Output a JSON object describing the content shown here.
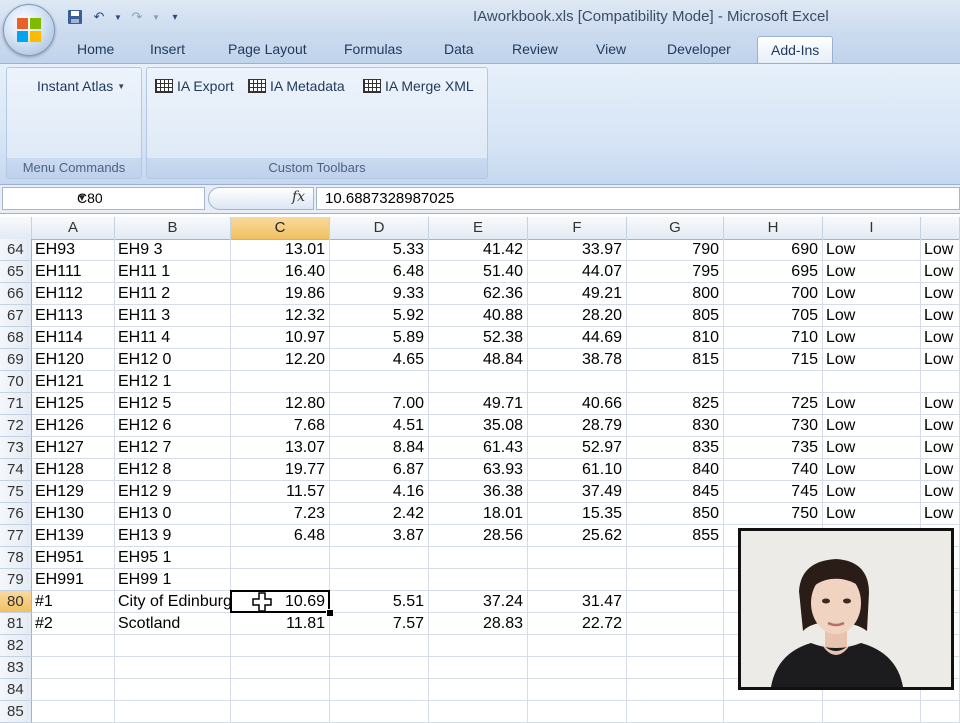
{
  "window": {
    "title": "IAworkbook.xls  [Compatibility Mode] - Microsoft Excel"
  },
  "qat": {
    "icons": [
      "save-icon",
      "undo-icon",
      "redo-icon",
      "customize-icon"
    ]
  },
  "tabs": [
    "Home",
    "Insert",
    "Page Layout",
    "Formulas",
    "Data",
    "Review",
    "View",
    "Developer",
    "Add-Ins"
  ],
  "active_tab": "Add-Ins",
  "ribbon": {
    "menu_commands": {
      "label": "Menu Commands",
      "button": "Instant Atlas"
    },
    "custom_toolbars": {
      "label": "Custom Toolbars",
      "buttons": [
        "IA Export",
        "IA Metadata",
        "IA Merge XML"
      ]
    }
  },
  "formula_bar": {
    "name_box": "C80",
    "fx": "fx",
    "value": "10.6887328987025"
  },
  "columns": [
    "A",
    "B",
    "C",
    "D",
    "E",
    "F",
    "G",
    "H",
    "I",
    ""
  ],
  "selected_column": "C",
  "rows": [
    {
      "num": "64",
      "cells": [
        "EH93",
        "EH9 3",
        "13.01",
        "5.33",
        "41.42",
        "33.97",
        "790",
        "690",
        "Low",
        "Low"
      ]
    },
    {
      "num": "65",
      "cells": [
        "EH111",
        "EH11 1",
        "16.40",
        "6.48",
        "51.40",
        "44.07",
        "795",
        "695",
        "Low",
        "Low"
      ]
    },
    {
      "num": "66",
      "cells": [
        "EH112",
        "EH11 2",
        "19.86",
        "9.33",
        "62.36",
        "49.21",
        "800",
        "700",
        "Low",
        "Low"
      ]
    },
    {
      "num": "67",
      "cells": [
        "EH113",
        "EH11 3",
        "12.32",
        "5.92",
        "40.88",
        "28.20",
        "805",
        "705",
        "Low",
        "Low"
      ]
    },
    {
      "num": "68",
      "cells": [
        "EH114",
        "EH11 4",
        "10.97",
        "5.89",
        "52.38",
        "44.69",
        "810",
        "710",
        "Low",
        "Low"
      ]
    },
    {
      "num": "69",
      "cells": [
        "EH120",
        "EH12 0",
        "12.20",
        "4.65",
        "48.84",
        "38.78",
        "815",
        "715",
        "Low",
        "Low"
      ]
    },
    {
      "num": "70",
      "cells": [
        "EH121",
        "EH12 1",
        "",
        "",
        "",
        "",
        "",
        "",
        "",
        ""
      ]
    },
    {
      "num": "71",
      "cells": [
        "EH125",
        "EH12 5",
        "12.80",
        "7.00",
        "49.71",
        "40.66",
        "825",
        "725",
        "Low",
        "Low"
      ]
    },
    {
      "num": "72",
      "cells": [
        "EH126",
        "EH12 6",
        "7.68",
        "4.51",
        "35.08",
        "28.79",
        "830",
        "730",
        "Low",
        "Low"
      ]
    },
    {
      "num": "73",
      "cells": [
        "EH127",
        "EH12 7",
        "13.07",
        "8.84",
        "61.43",
        "52.97",
        "835",
        "735",
        "Low",
        "Low"
      ]
    },
    {
      "num": "74",
      "cells": [
        "EH128",
        "EH12 8",
        "19.77",
        "6.87",
        "63.93",
        "61.10",
        "840",
        "740",
        "Low",
        "Low"
      ]
    },
    {
      "num": "75",
      "cells": [
        "EH129",
        "EH12 9",
        "11.57",
        "4.16",
        "36.38",
        "37.49",
        "845",
        "745",
        "Low",
        "Low"
      ]
    },
    {
      "num": "76",
      "cells": [
        "EH130",
        "EH13 0",
        "7.23",
        "2.42",
        "18.01",
        "15.35",
        "850",
        "750",
        "Low",
        "Low"
      ]
    },
    {
      "num": "77",
      "cells": [
        "EH139",
        "EH13 9",
        "6.48",
        "3.87",
        "28.56",
        "25.62",
        "855",
        "",
        "",
        ""
      ]
    },
    {
      "num": "78",
      "cells": [
        "EH951",
        "EH95 1",
        "",
        "",
        "",
        "",
        "",
        "",
        "",
        ""
      ]
    },
    {
      "num": "79",
      "cells": [
        "EH991",
        "EH99 1",
        "",
        "",
        "",
        "",
        "",
        "",
        "",
        ""
      ]
    },
    {
      "num": "80",
      "cells": [
        "#1",
        "City of Edinburgh",
        "10.69",
        "5.51",
        "37.24",
        "31.47",
        "",
        "",
        "",
        ""
      ]
    },
    {
      "num": "81",
      "cells": [
        "#2",
        "Scotland",
        "11.81",
        "7.57",
        "28.83",
        "22.72",
        "",
        "",
        "",
        ""
      ]
    },
    {
      "num": "82",
      "cells": [
        "",
        "",
        "",
        "",
        "",
        "",
        "",
        "",
        "",
        ""
      ]
    },
    {
      "num": "83",
      "cells": [
        "",
        "",
        "",
        "",
        "",
        "",
        "",
        "",
        "",
        ""
      ]
    },
    {
      "num": "84",
      "cells": [
        "",
        "",
        "",
        "",
        "",
        "",
        "",
        "",
        "",
        ""
      ]
    },
    {
      "num": "85",
      "cells": [
        "",
        "",
        "",
        "",
        "",
        "",
        "",
        "",
        "",
        ""
      ]
    }
  ],
  "selected_row": "80",
  "active_cell": "C80",
  "colors": {
    "selected_header": "#f1c15f",
    "ribbon": "#d4e3f5"
  },
  "webcam": {
    "icon": "presenter-video-overlay"
  }
}
